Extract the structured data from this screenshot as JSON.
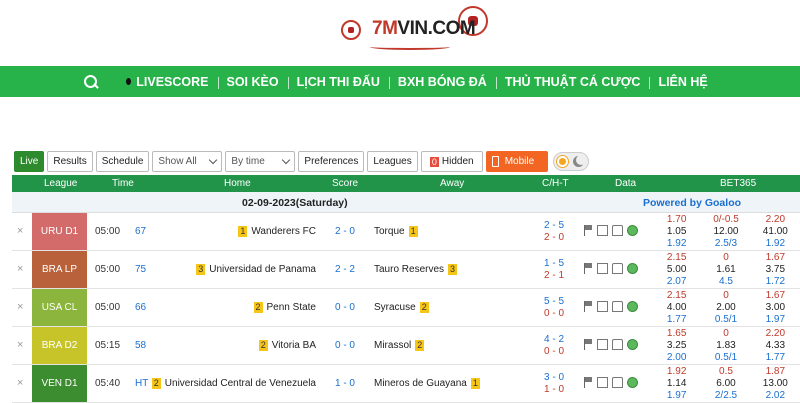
{
  "logo": {
    "brand_num": "7M",
    "brand_rest": "VIN.COM"
  },
  "nav": {
    "items": [
      {
        "label": "LIVESCORE",
        "dot": true
      },
      {
        "label": "SOI KÈO"
      },
      {
        "label": "LỊCH THI ĐẤU"
      },
      {
        "label": "BXH BÓNG ĐÁ"
      },
      {
        "label": "THỦ THUẬT CÁ CƯỢC"
      },
      {
        "label": "LIÊN HỆ"
      }
    ]
  },
  "toolbar": {
    "live": "Live",
    "results": "Results",
    "schedule": "Schedule",
    "show_all": "Show All",
    "by_time": "By time",
    "preferences": "Preferences",
    "leagues": "Leagues",
    "hidden_count": "0",
    "hidden_label": "Hidden",
    "mobile": "Mobile"
  },
  "table": {
    "headers": {
      "league": "League",
      "time": "Time",
      "home": "Home",
      "score": "Score",
      "away": "Away",
      "cht": "C/H-T",
      "data": "Data",
      "odds": "BET365"
    },
    "date": "02-09-2023(Saturday)",
    "powered": "Powered by Goaloo",
    "rows": [
      {
        "league": "URU D1",
        "color": "#d36b6b",
        "time": "05:00",
        "minute": "67",
        "home_rank": "1",
        "home": "Wanderers FC",
        "score": "2 - 0",
        "away": "Torque",
        "away_rank": "1",
        "c": "2 - 5",
        "ht": "2 - 0",
        "o1": [
          "1.70",
          "0/-0.5",
          "2.20"
        ],
        "o2": [
          "1.05",
          "12.00",
          "41.00"
        ],
        "o3": [
          "1.92",
          "2.5/3",
          "1.92"
        ]
      },
      {
        "league": "BRA LP",
        "color": "#b8613a",
        "time": "05:00",
        "minute": "75",
        "home_rank": "3",
        "home": "Universidad de Panama",
        "score": "2 - 2",
        "away": "Tauro Reserves",
        "away_rank": "3",
        "c": "1 - 5",
        "ht": "2 - 1",
        "o1": [
          "2.15",
          "0",
          "1.67"
        ],
        "o2": [
          "5.00",
          "1.61",
          "3.75"
        ],
        "o3": [
          "2.07",
          "4.5",
          "1.72"
        ]
      },
      {
        "league": "USA CL",
        "color": "#8bb53c",
        "time": "05:00",
        "minute": "66",
        "home_rank": "2",
        "home": "Penn State",
        "score": "0 - 0",
        "away": "Syracuse",
        "away_rank": "2",
        "c": "5 - 5",
        "ht": "0 - 0",
        "o1": [
          "2.15",
          "0",
          "1.67"
        ],
        "o2": [
          "4.00",
          "2.00",
          "3.00"
        ],
        "o3": [
          "1.77",
          "0.5/1",
          "1.97"
        ]
      },
      {
        "league": "BRA D2",
        "color": "#c7c42a",
        "time": "05:15",
        "minute": "58",
        "home_rank": "2",
        "home": "Vitoria BA",
        "score": "0 - 0",
        "away": "Mirassol",
        "away_rank": "2",
        "c": "4 - 2",
        "ht": "0 - 0",
        "o1": [
          "1.65",
          "0",
          "2.20"
        ],
        "o2": [
          "3.25",
          "1.83",
          "4.33"
        ],
        "o3": [
          "2.00",
          "0.5/1",
          "1.77"
        ]
      },
      {
        "league": "VEN D1",
        "color": "#3c8d2f",
        "time": "05:40",
        "minute": "HT",
        "home_rank": "2",
        "home": "Universidad Central de Venezuela",
        "score": "1 - 0",
        "away": "Mineros de Guayana",
        "away_rank": "1",
        "c": "3 - 0",
        "ht": "1 - 0",
        "o1": [
          "1.92",
          "0.5",
          "1.87"
        ],
        "o2": [
          "1.14",
          "6.00",
          "13.00"
        ],
        "o3": [
          "1.97",
          "2/2.5",
          "2.02"
        ]
      }
    ]
  }
}
